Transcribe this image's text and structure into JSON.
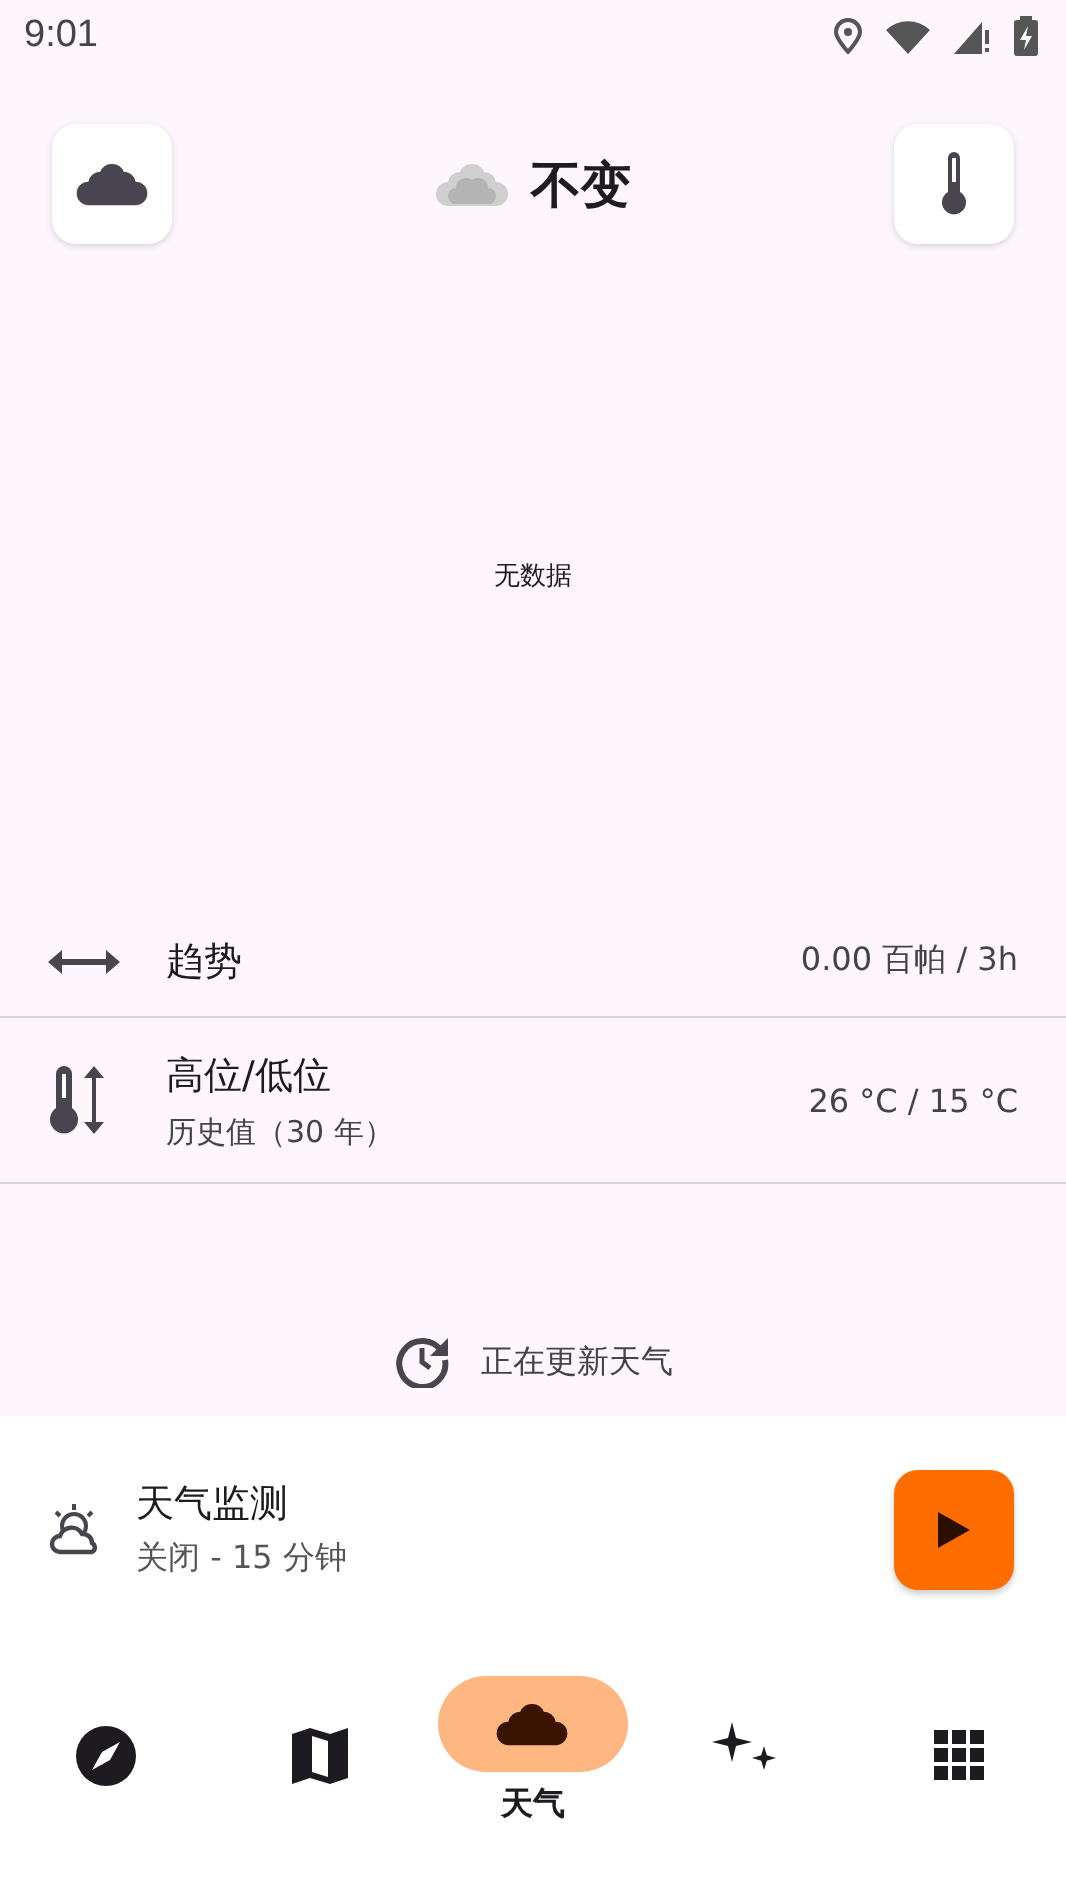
{
  "status_bar": {
    "time": "9:01"
  },
  "header": {
    "title": "不变"
  },
  "chart": {
    "empty_text": "无数据"
  },
  "rows": [
    {
      "kind": "trend",
      "title": "趋势",
      "value": "0.00 百帕 / 3h"
    },
    {
      "kind": "temperature",
      "title": "高位/低位",
      "subtitle": "历史值（30 年）",
      "value": "26 °C / 15 °C"
    }
  ],
  "updating": {
    "text": "正在更新天气"
  },
  "monitor": {
    "title": "天气监测",
    "subtitle": "关闭 - 15 分钟",
    "running": false
  },
  "nav": [
    {
      "kind": "compass",
      "selected": false
    },
    {
      "kind": "map",
      "selected": false
    },
    {
      "kind": "weather",
      "selected": true,
      "label": "天气"
    },
    {
      "kind": "sparkle",
      "selected": false
    },
    {
      "kind": "grid",
      "selected": false
    }
  ]
}
